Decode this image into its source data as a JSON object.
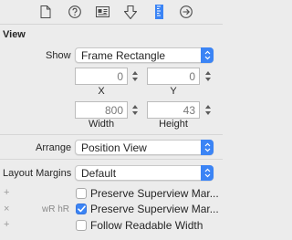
{
  "tabs": [
    {
      "name": "file-inspector",
      "icon": "file-icon"
    },
    {
      "name": "quick-help",
      "icon": "question-icon"
    },
    {
      "name": "identity-inspector",
      "icon": "identity-card-icon"
    },
    {
      "name": "attributes-inspector",
      "icon": "attributes-shield-icon"
    },
    {
      "name": "size-inspector",
      "icon": "ruler-icon",
      "selected": true
    },
    {
      "name": "connections-inspector",
      "icon": "arrow-circle-icon"
    }
  ],
  "section": {
    "title": "View"
  },
  "show": {
    "label": "Show",
    "value": "Frame Rectangle"
  },
  "frame": {
    "x": {
      "value": "0",
      "label": "X"
    },
    "y": {
      "value": "0",
      "label": "Y"
    },
    "width": {
      "value": "800",
      "label": "Width"
    },
    "height": {
      "value": "43",
      "label": "Height"
    }
  },
  "arrange": {
    "label": "Arrange",
    "value": "Position View"
  },
  "layout_margins": {
    "label": "Layout Margins",
    "value": "Default"
  },
  "options": [
    {
      "add": "+",
      "trait": "",
      "label": "Preserve Superview Mar...",
      "checked": false
    },
    {
      "add": "×",
      "trait": "wR hR",
      "label": "Preserve Superview Mar...",
      "checked": true
    },
    {
      "add": "+",
      "trait": "",
      "label": "Follow Readable Width",
      "checked": false
    }
  ],
  "colors": {
    "accent": "#3b84f5",
    "background": "#ececec"
  }
}
